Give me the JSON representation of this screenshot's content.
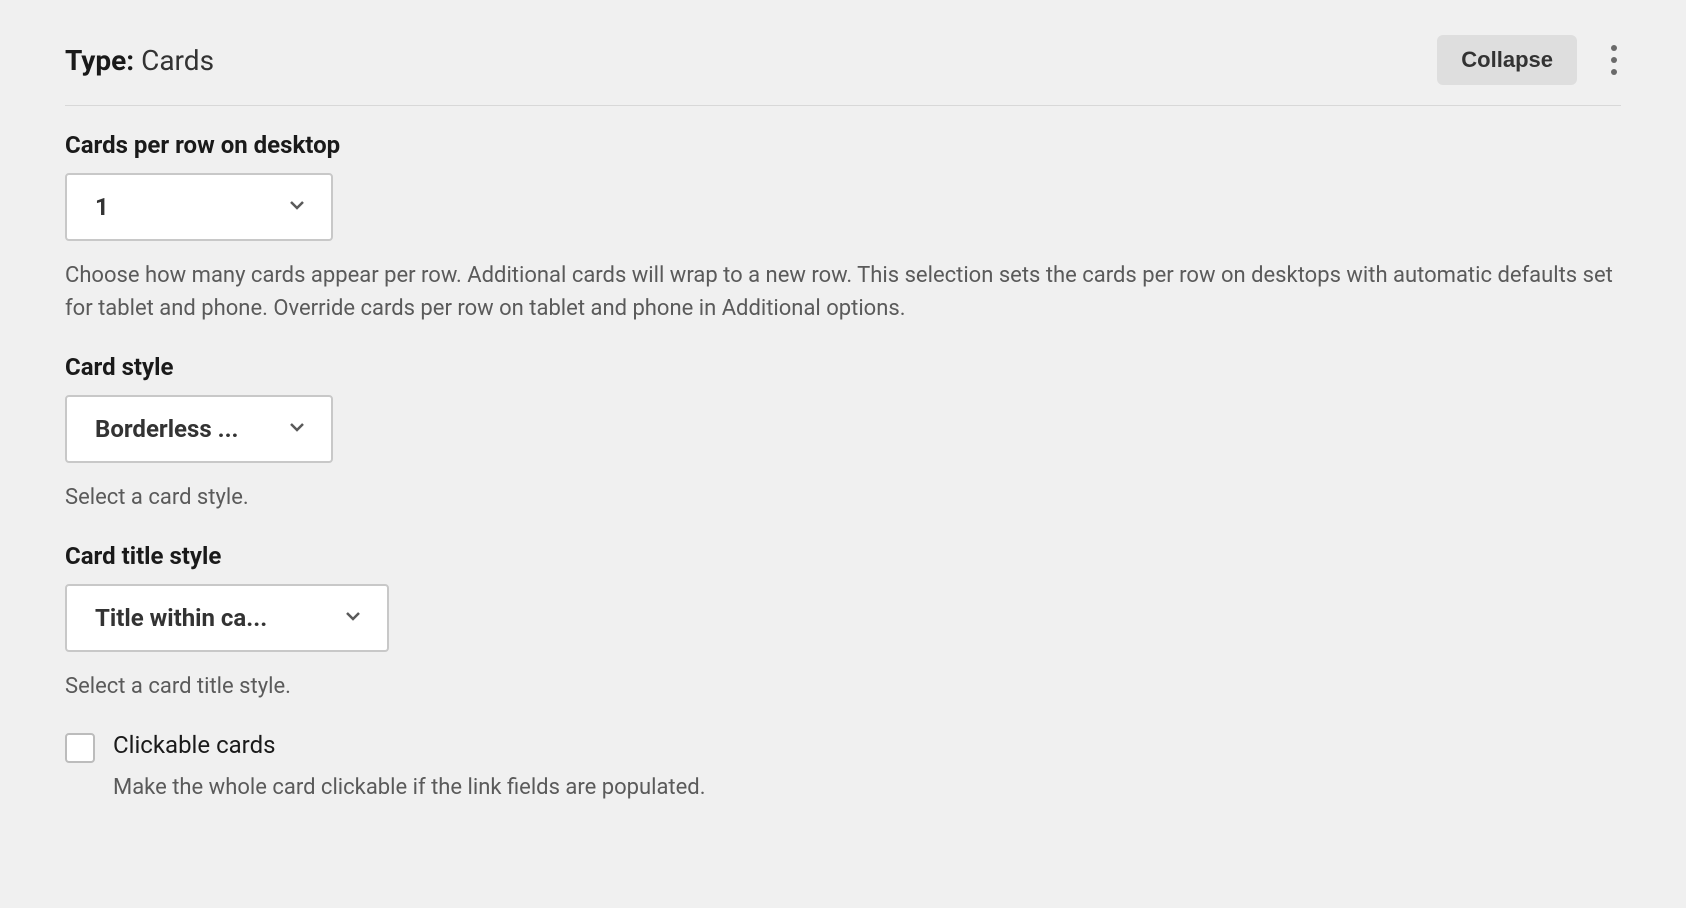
{
  "header": {
    "type_label": "Type:",
    "type_value": "Cards",
    "collapse_label": "Collapse"
  },
  "fields": {
    "cards_per_row": {
      "label": "Cards per row on desktop",
      "value": "1",
      "help": "Choose how many cards appear per row. Additional cards will wrap to a new row. This selection sets the cards per row on desktops with automatic defaults set for tablet and phone. Override cards per row on tablet and phone in Additional options."
    },
    "card_style": {
      "label": "Card style",
      "value": "Borderless ...",
      "help": "Select a card style."
    },
    "card_title_style": {
      "label": "Card title style",
      "value": "Title within ca...",
      "help": "Select a card title style."
    },
    "clickable_cards": {
      "label": "Clickable cards",
      "help": "Make the whole card clickable if the link fields are populated."
    }
  }
}
